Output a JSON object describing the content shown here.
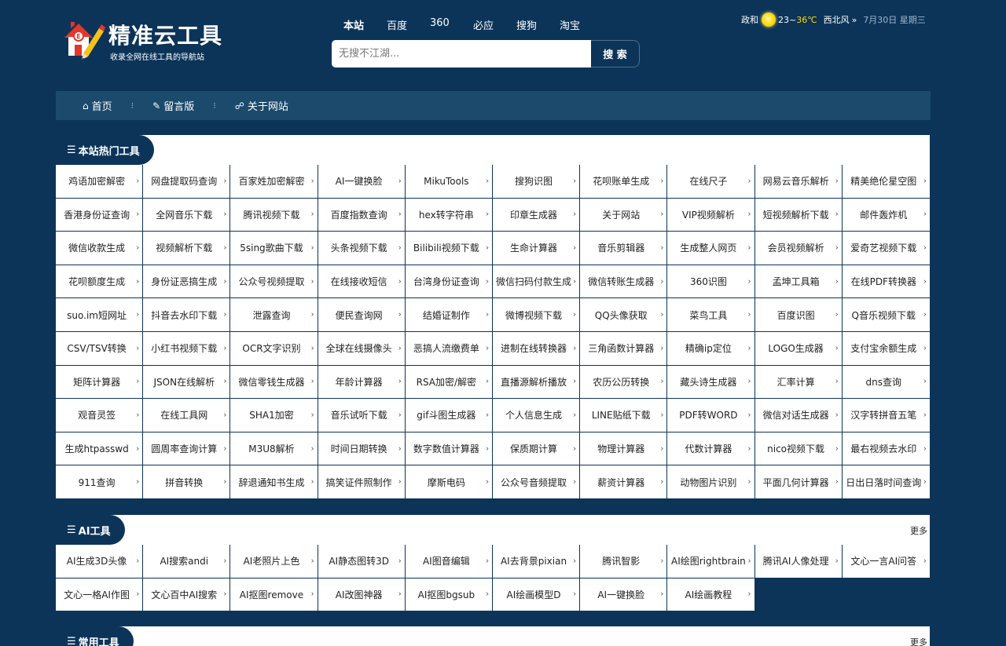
{
  "header": {
    "logo_title": "精准云工具",
    "logo_subtitle": "收录全网在线工具的导航站",
    "engines": [
      "本站",
      "百度",
      "360",
      "必应",
      "搜狗",
      "淘宝"
    ],
    "active_engine": "本站",
    "search_placeholder": "无搜不江湖...",
    "search_button": "搜 索",
    "weather": {
      "city": "政和",
      "temp_low": "23",
      "temp_sep": "~",
      "temp_high": "36℃",
      "wind": "西北风",
      "arrow": "»",
      "date": "7月30日 星期三"
    }
  },
  "nav": {
    "items": [
      {
        "icon": "home-icon",
        "label": "首页"
      },
      {
        "icon": "edit-icon",
        "label": "留言版"
      },
      {
        "icon": "link-icon",
        "label": "关于网站"
      }
    ]
  },
  "sections": [
    {
      "title": "本站热门工具",
      "more": "",
      "items": [
        "鸡语加密解密",
        "网盘提取码查询",
        "百家姓加密解密",
        "AI一键换脸",
        "MikuTools",
        "搜狗识图",
        "花呗账单生成",
        "在线尺子",
        "网易云音乐解析",
        "精美绝伦星空图",
        "香港身份证查询",
        "全网音乐下载",
        "腾讯视频下载",
        "百度指数查询",
        "hex转字符串",
        "印章生成器",
        "关于网站",
        "VIP视频解析",
        "短视频解析下载",
        "邮件轰炸机",
        "微信收款生成",
        "视频解析下载",
        "5sing歌曲下载",
        "头条视频下载",
        "Bilibili视频下载",
        "生命计算器",
        "音乐剪辑器",
        "生成整人网页",
        "会员视频解析",
        "爱奇艺视频下载",
        "花呗额度生成",
        "身份证恶搞生成",
        "公众号视频提取",
        "在线接收短信",
        "台湾身份证查询",
        "微信扫码付款生成",
        "微信转账生成器",
        "360识图",
        "孟坤工具箱",
        "在线PDF转换器",
        "suo.im短网址",
        "抖音去水印下载",
        "泄露查询",
        "便民查询网",
        "结婚证制作",
        "微博视频下载",
        "QQ头像获取",
        "菜鸟工具",
        "百度识图",
        "Q音乐视频下载",
        "CSV/TSV转换",
        "小红书视频下载",
        "OCR文字识别",
        "全球在线摄像头",
        "恶搞人流缴费单",
        "进制在线转换器",
        "三角函数计算器",
        "精确ip定位",
        "LOGO生成器",
        "支付宝余额生成",
        "矩阵计算器",
        "JSON在线解析",
        "微信零钱生成器",
        "年龄计算器",
        "RSA加密/解密",
        "直播源解析播放",
        "农历公历转换",
        "藏头诗生成器",
        "汇率计算",
        "dns查询",
        "观音灵签",
        "在线工具网",
        "SHA1加密",
        "音乐试听下载",
        "gif斗图生成器",
        "个人信息生成",
        "LINE贴纸下载",
        "PDF转WORD",
        "微信对话生成器",
        "汉字转拼音五笔",
        "生成htpasswd",
        "圆周率查询计算",
        "M3U8解析",
        "时间日期转换",
        "数字数值计算器",
        "保质期计算",
        "物理计算器",
        "代数计算器",
        "nico视频下载",
        "最右视频去水印",
        "911查询",
        "拼音转换",
        "辞退通知书生成",
        "搞笑证件照制作",
        "摩斯电码",
        "公众号音频提取",
        "薪资计算器",
        "动物图片识别",
        "平面几何计算器",
        "日出日落时间查询"
      ]
    },
    {
      "title": "AI工具",
      "more": "更多",
      "items": [
        "AI生成3D头像",
        "AI搜索andi",
        "AI老照片上色",
        "AI静态图转3D",
        "AI图音编辑",
        "AI去背景pixian",
        "腾讯智影",
        "AI绘图rightbrain",
        "腾讯AI人像处理",
        "文心一言AI问答",
        "文心一格AI作图",
        "文心百中AI搜索",
        "AI抠图remove",
        "AI改图神器",
        "AI抠图bgsub",
        "AI绘画模型D",
        "AI一键换脸",
        "AI绘画教程"
      ]
    },
    {
      "title": "常用工具",
      "more": "更多",
      "items": []
    }
  ]
}
